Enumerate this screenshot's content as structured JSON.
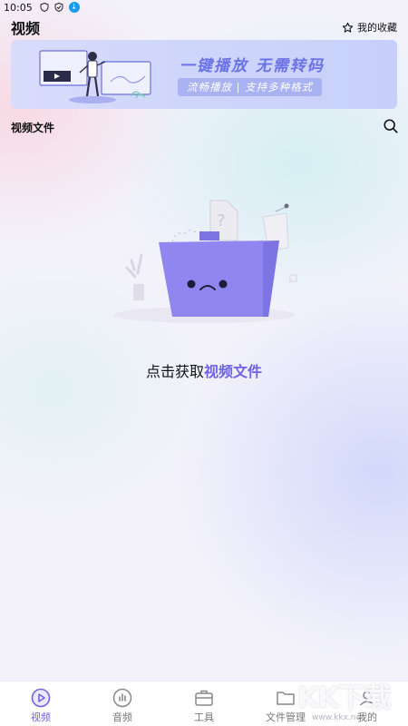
{
  "status_bar": {
    "time": "10:05"
  },
  "header": {
    "title": "视频",
    "favorites_label": "我的收藏"
  },
  "banner": {
    "title": "一键播放 无需转码",
    "subtitle": "流畅播放 | 支持多种格式"
  },
  "section": {
    "title": "视频文件"
  },
  "empty_state": {
    "prefix": "点击获取",
    "accent": "视频文件"
  },
  "tabs": [
    {
      "label": "视频",
      "icon": "play-circle-icon",
      "active": true
    },
    {
      "label": "音频",
      "icon": "audio-bars-icon",
      "active": false
    },
    {
      "label": "工具",
      "icon": "toolbox-icon",
      "active": false
    },
    {
      "label": "文件管理",
      "icon": "folder-icon",
      "active": false
    },
    {
      "label": "我的",
      "icon": "user-icon",
      "active": false
    }
  ],
  "watermark": {
    "text": "KK下载",
    "url": "www.kkx.net"
  },
  "colors": {
    "accent": "#6e64e0",
    "banner_title": "#6b72e8",
    "folder": "#8f86f0"
  }
}
